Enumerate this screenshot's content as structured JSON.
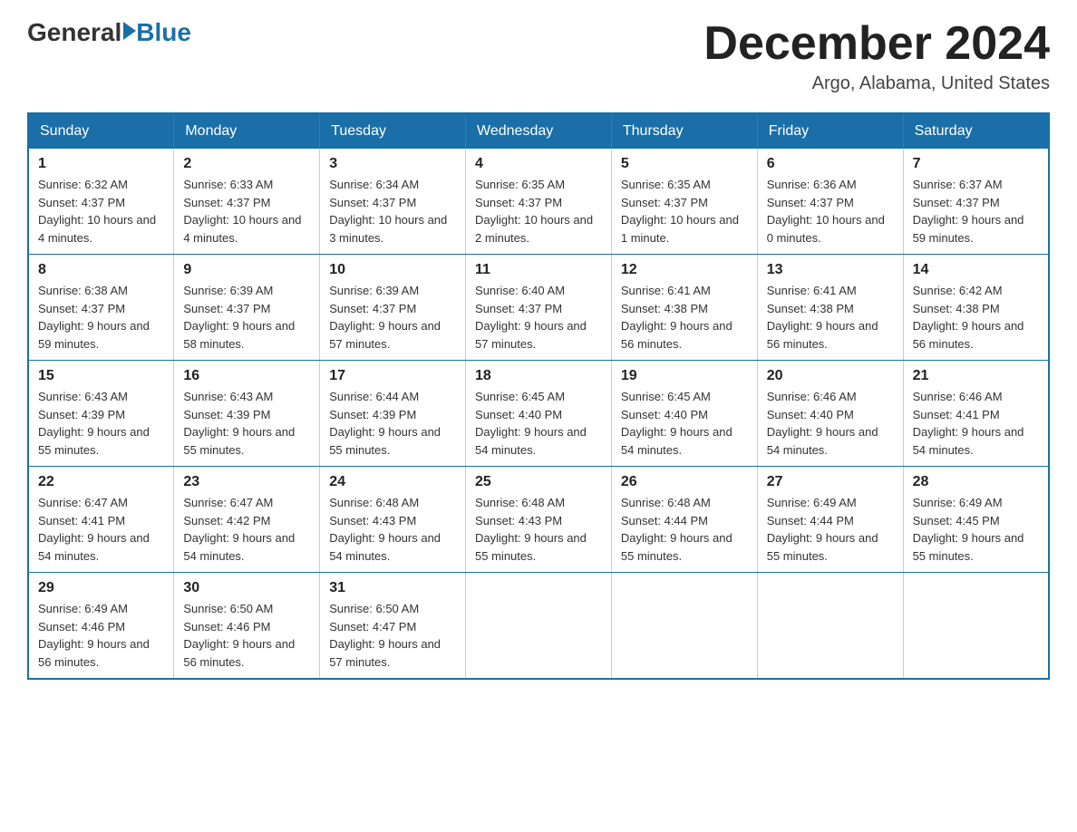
{
  "header": {
    "logo": {
      "general": "General",
      "blue": "Blue"
    },
    "title": "December 2024",
    "location": "Argo, Alabama, United States"
  },
  "days_of_week": [
    "Sunday",
    "Monday",
    "Tuesday",
    "Wednesday",
    "Thursday",
    "Friday",
    "Saturday"
  ],
  "weeks": [
    [
      {
        "day": "1",
        "sunrise": "6:32 AM",
        "sunset": "4:37 PM",
        "daylight": "10 hours and 4 minutes."
      },
      {
        "day": "2",
        "sunrise": "6:33 AM",
        "sunset": "4:37 PM",
        "daylight": "10 hours and 4 minutes."
      },
      {
        "day": "3",
        "sunrise": "6:34 AM",
        "sunset": "4:37 PM",
        "daylight": "10 hours and 3 minutes."
      },
      {
        "day": "4",
        "sunrise": "6:35 AM",
        "sunset": "4:37 PM",
        "daylight": "10 hours and 2 minutes."
      },
      {
        "day": "5",
        "sunrise": "6:35 AM",
        "sunset": "4:37 PM",
        "daylight": "10 hours and 1 minute."
      },
      {
        "day": "6",
        "sunrise": "6:36 AM",
        "sunset": "4:37 PM",
        "daylight": "10 hours and 0 minutes."
      },
      {
        "day": "7",
        "sunrise": "6:37 AM",
        "sunset": "4:37 PM",
        "daylight": "9 hours and 59 minutes."
      }
    ],
    [
      {
        "day": "8",
        "sunrise": "6:38 AM",
        "sunset": "4:37 PM",
        "daylight": "9 hours and 59 minutes."
      },
      {
        "day": "9",
        "sunrise": "6:39 AM",
        "sunset": "4:37 PM",
        "daylight": "9 hours and 58 minutes."
      },
      {
        "day": "10",
        "sunrise": "6:39 AM",
        "sunset": "4:37 PM",
        "daylight": "9 hours and 57 minutes."
      },
      {
        "day": "11",
        "sunrise": "6:40 AM",
        "sunset": "4:37 PM",
        "daylight": "9 hours and 57 minutes."
      },
      {
        "day": "12",
        "sunrise": "6:41 AM",
        "sunset": "4:38 PM",
        "daylight": "9 hours and 56 minutes."
      },
      {
        "day": "13",
        "sunrise": "6:41 AM",
        "sunset": "4:38 PM",
        "daylight": "9 hours and 56 minutes."
      },
      {
        "day": "14",
        "sunrise": "6:42 AM",
        "sunset": "4:38 PM",
        "daylight": "9 hours and 56 minutes."
      }
    ],
    [
      {
        "day": "15",
        "sunrise": "6:43 AM",
        "sunset": "4:39 PM",
        "daylight": "9 hours and 55 minutes."
      },
      {
        "day": "16",
        "sunrise": "6:43 AM",
        "sunset": "4:39 PM",
        "daylight": "9 hours and 55 minutes."
      },
      {
        "day": "17",
        "sunrise": "6:44 AM",
        "sunset": "4:39 PM",
        "daylight": "9 hours and 55 minutes."
      },
      {
        "day": "18",
        "sunrise": "6:45 AM",
        "sunset": "4:40 PM",
        "daylight": "9 hours and 54 minutes."
      },
      {
        "day": "19",
        "sunrise": "6:45 AM",
        "sunset": "4:40 PM",
        "daylight": "9 hours and 54 minutes."
      },
      {
        "day": "20",
        "sunrise": "6:46 AM",
        "sunset": "4:40 PM",
        "daylight": "9 hours and 54 minutes."
      },
      {
        "day": "21",
        "sunrise": "6:46 AM",
        "sunset": "4:41 PM",
        "daylight": "9 hours and 54 minutes."
      }
    ],
    [
      {
        "day": "22",
        "sunrise": "6:47 AM",
        "sunset": "4:41 PM",
        "daylight": "9 hours and 54 minutes."
      },
      {
        "day": "23",
        "sunrise": "6:47 AM",
        "sunset": "4:42 PM",
        "daylight": "9 hours and 54 minutes."
      },
      {
        "day": "24",
        "sunrise": "6:48 AM",
        "sunset": "4:43 PM",
        "daylight": "9 hours and 54 minutes."
      },
      {
        "day": "25",
        "sunrise": "6:48 AM",
        "sunset": "4:43 PM",
        "daylight": "9 hours and 55 minutes."
      },
      {
        "day": "26",
        "sunrise": "6:48 AM",
        "sunset": "4:44 PM",
        "daylight": "9 hours and 55 minutes."
      },
      {
        "day": "27",
        "sunrise": "6:49 AM",
        "sunset": "4:44 PM",
        "daylight": "9 hours and 55 minutes."
      },
      {
        "day": "28",
        "sunrise": "6:49 AM",
        "sunset": "4:45 PM",
        "daylight": "9 hours and 55 minutes."
      }
    ],
    [
      {
        "day": "29",
        "sunrise": "6:49 AM",
        "sunset": "4:46 PM",
        "daylight": "9 hours and 56 minutes."
      },
      {
        "day": "30",
        "sunrise": "6:50 AM",
        "sunset": "4:46 PM",
        "daylight": "9 hours and 56 minutes."
      },
      {
        "day": "31",
        "sunrise": "6:50 AM",
        "sunset": "4:47 PM",
        "daylight": "9 hours and 57 minutes."
      },
      null,
      null,
      null,
      null
    ]
  ],
  "labels": {
    "sunrise": "Sunrise:",
    "sunset": "Sunset:",
    "daylight": "Daylight:"
  }
}
